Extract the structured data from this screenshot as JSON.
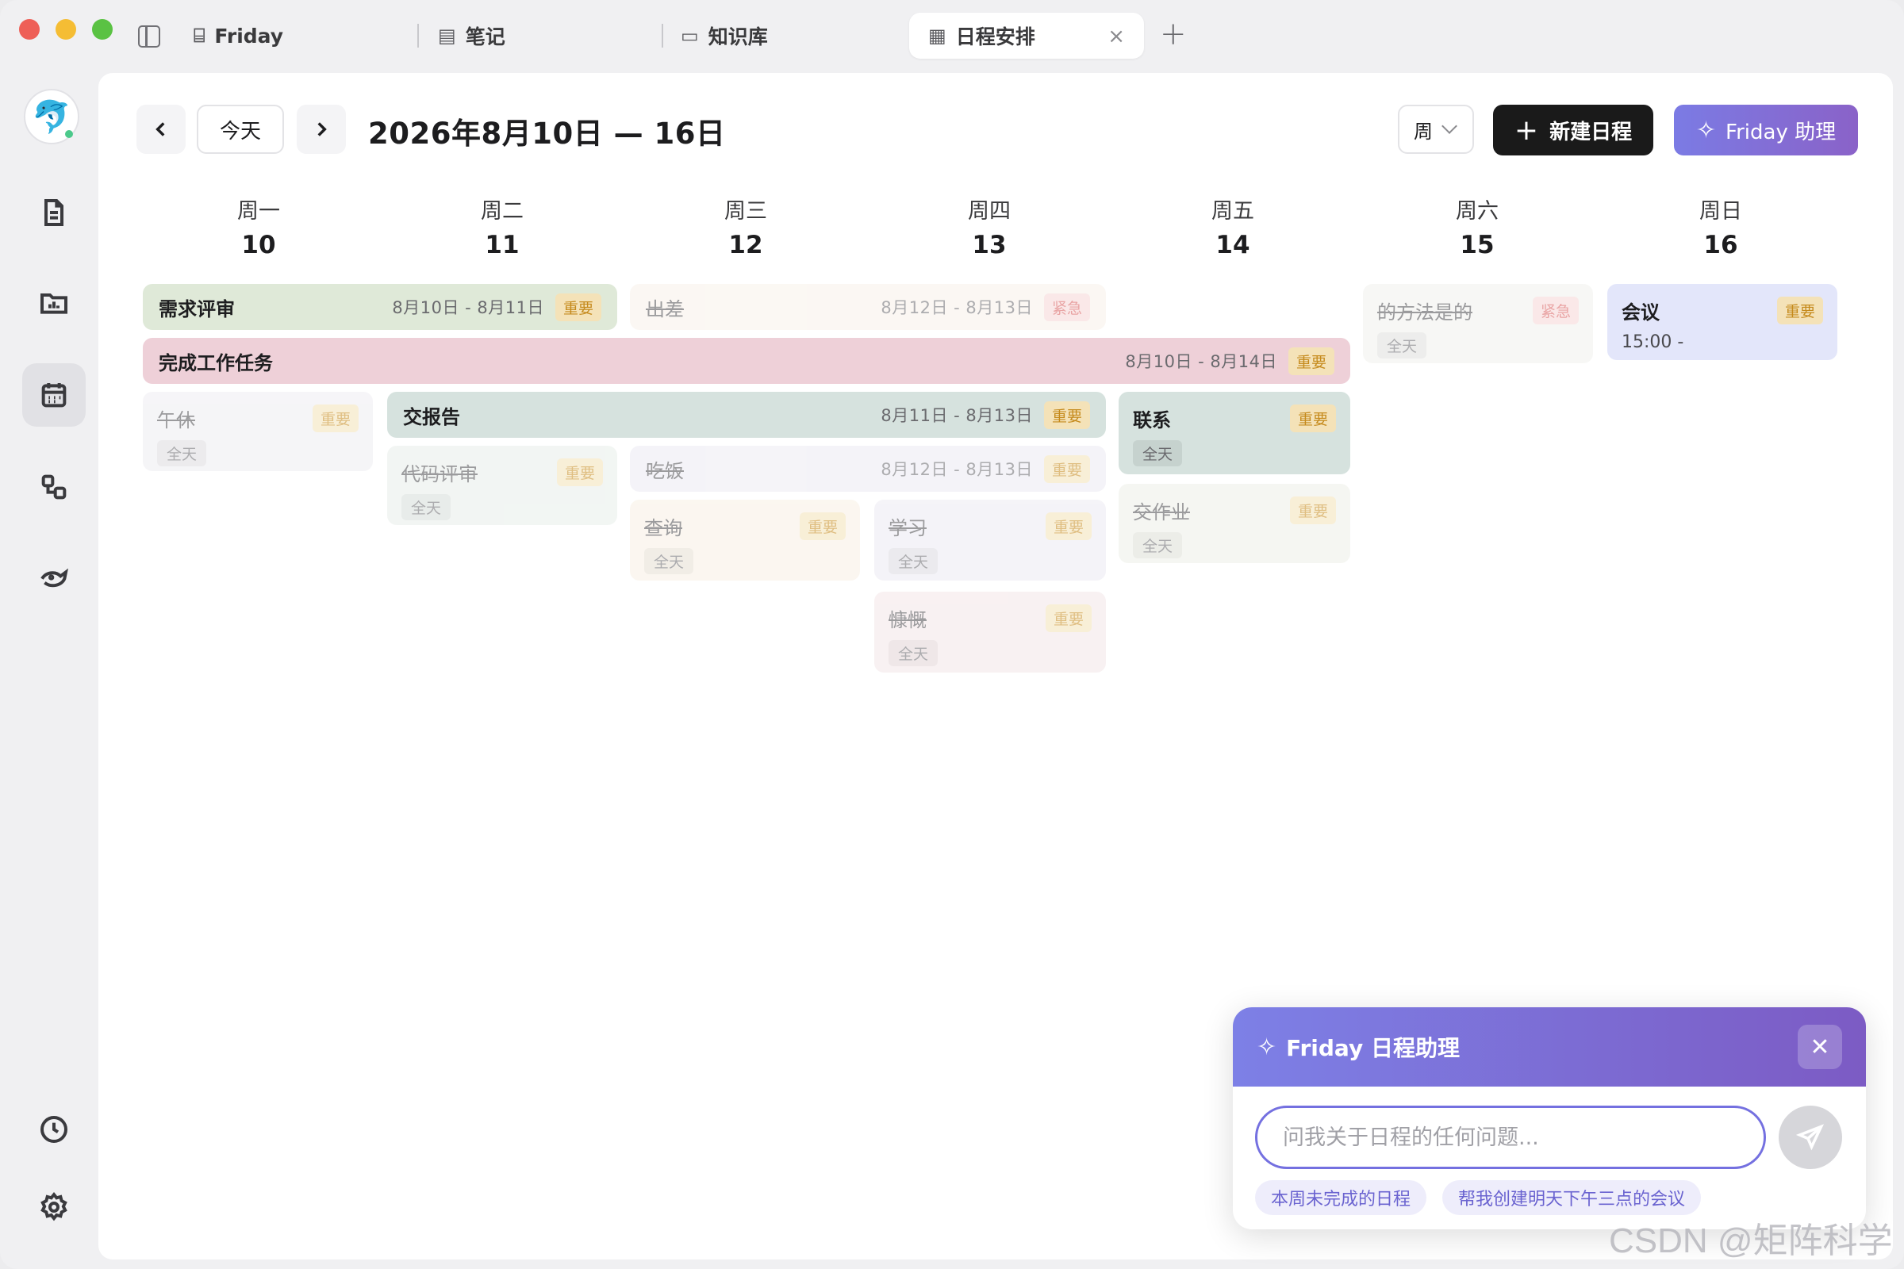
{
  "tabs": [
    {
      "label": "Friday",
      "icon": "robot-icon"
    },
    {
      "label": "笔记",
      "icon": "document-icon"
    },
    {
      "label": "知识库",
      "icon": "folder-icon"
    },
    {
      "label": "日程安排",
      "icon": "calendar-icon",
      "active": true
    }
  ],
  "toolbar": {
    "today_label": "今天",
    "range_title": "2026年8月10日 — 16日",
    "view_value": "周",
    "new_label": "新建日程",
    "ai_label": "Friday 助理"
  },
  "days": [
    {
      "name": "周一",
      "num": "10"
    },
    {
      "name": "周二",
      "num": "11"
    },
    {
      "name": "周三",
      "num": "12"
    },
    {
      "name": "周四",
      "num": "13"
    },
    {
      "name": "周五",
      "num": "14"
    },
    {
      "name": "周六",
      "num": "15"
    },
    {
      "name": "周日",
      "num": "16"
    }
  ],
  "events": {
    "e1": {
      "title": "需求评审",
      "dates": "8月10日 - 8月11日",
      "badge": "重要"
    },
    "e2": {
      "title": "出差",
      "dates": "8月12日 - 8月13日",
      "badge": "紧急",
      "done": true
    },
    "e3": {
      "title": "的方法是的",
      "allday": "全天",
      "badge": "紧急",
      "done": true
    },
    "e4": {
      "title": "会议",
      "time": "15:00 -",
      "badge": "重要"
    },
    "e5": {
      "title": "完成工作任务",
      "dates": "8月10日 - 8月14日",
      "badge": "重要"
    },
    "e6": {
      "title": "午休",
      "allday": "全天",
      "badge": "重要",
      "done": true
    },
    "e7": {
      "title": "交报告",
      "dates": "8月11日 - 8月13日",
      "badge": "重要"
    },
    "e8": {
      "title": "联系",
      "allday": "全天",
      "badge": "重要"
    },
    "e9": {
      "title": "代码评审",
      "allday": "全天",
      "badge": "重要",
      "done": true
    },
    "e10": {
      "title": "吃饭",
      "dates": "8月12日 - 8月13日",
      "badge": "重要",
      "done": true
    },
    "e11": {
      "title": "交作业",
      "allday": "全天",
      "badge": "重要",
      "done": true
    },
    "e12": {
      "title": "查询",
      "allday": "全天",
      "badge": "重要",
      "done": true
    },
    "e13": {
      "title": "学习",
      "allday": "全天",
      "badge": "重要",
      "done": true
    },
    "e14": {
      "title": "慷慨",
      "allday": "全天",
      "badge": "重要",
      "done": true
    }
  },
  "assistant": {
    "title": "Friday 日程助理",
    "placeholder": "问我关于日程的任何问题...",
    "chips": [
      "本周未完成的日程",
      "帮我创建明天下午三点的会议"
    ]
  },
  "watermark": "CSDN @矩阵科学",
  "colors": {
    "accent": "#7470e0",
    "important_badge": "#c58a1c",
    "urgent_badge": "#d85a5a"
  }
}
